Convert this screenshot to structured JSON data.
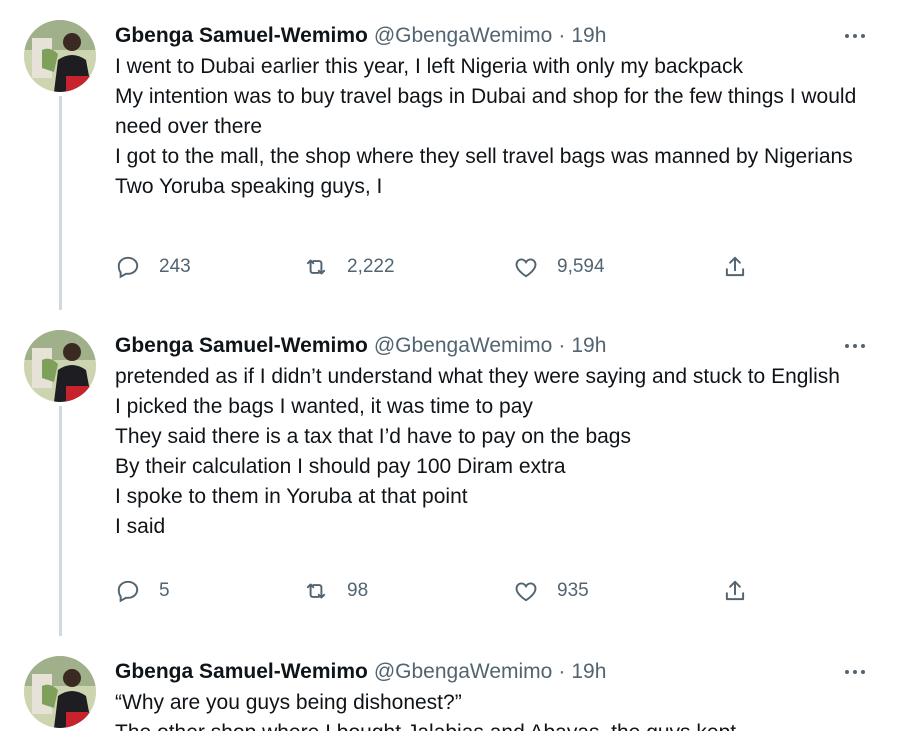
{
  "author": {
    "name": "Gbenga Samuel-Wemimo",
    "handle": "@GbengaWemimo",
    "separator": "·",
    "time": "19h"
  },
  "tweets": [
    {
      "lines": [
        "I went to Dubai earlier this year, I left Nigeria with only my backpack",
        "My intention was to buy travel bags in Dubai and shop for the few things I would need over there",
        "I got to the mall, the shop where they sell travel bags was manned by Nigerians",
        "Two Yoruba speaking guys, I"
      ],
      "replies": "243",
      "retweets": "2,222",
      "likes": "9,594"
    },
    {
      "lines": [
        "pretended as if I didn’t understand what they were saying and stuck to English",
        "I picked the bags I wanted, it was time to pay",
        "They said there is a tax that I’d have to pay on the bags",
        "By their calculation I should pay 100 Diram extra",
        "I spoke to them in Yoruba at that point",
        "I said"
      ],
      "replies": "5",
      "retweets": "98",
      "likes": "935"
    },
    {
      "lines": [
        "“Why are you guys being dishonest?”",
        "The other shop where I bought Jalabias and Abayas, the guys kept"
      ]
    }
  ],
  "icons": {
    "reply": "reply-icon",
    "retweet": "retweet-icon",
    "like": "like-icon",
    "share": "share-icon",
    "more": "more-icon"
  },
  "colors": {
    "text": "#0f1419",
    "muted": "#536471",
    "thread_line": "#cfd9de"
  }
}
